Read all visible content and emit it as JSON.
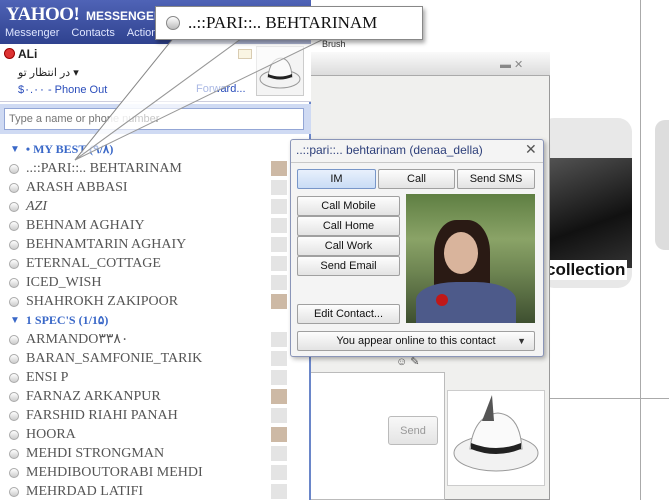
{
  "messenger": {
    "logo": "YAHOO!",
    "logo_sub": "MESSENGER",
    "menu": [
      "Messenger",
      "Contacts",
      "Actions"
    ],
    "user_name": "ALi",
    "user_status": "در انتظار تو",
    "phone_out": "$۰.۰۰ - Phone Out",
    "forward": "Forward...",
    "search_placeholder": "Type a name or phone number"
  },
  "groups": [
    {
      "label": "• MY BEST (۹/۸)",
      "contacts": [
        {
          "name": "..::PARI::.. BEHTARINAM",
          "pic": true
        },
        {
          "name": "ARASH ABBASI",
          "pic": false
        },
        {
          "name": "AZI",
          "pic": false
        },
        {
          "name": "BEHNAM AGHAIY",
          "pic": false
        },
        {
          "name": "BEHNAMTARIN AGHAIY",
          "pic": false
        },
        {
          "name": "ETERNAL_COTTAGE",
          "pic": false
        },
        {
          "name": "ICED_WISH",
          "pic": false
        },
        {
          "name": "SHAHROKH ZAKIPOOR",
          "pic": true
        }
      ]
    },
    {
      "label": "1 SPEC'S (1/1۵)",
      "contacts": [
        {
          "name": "ARMANDO۳۳۸۰",
          "pic": false
        },
        {
          "name": "BARAN_SAMFONIE_TARIK",
          "pic": false
        },
        {
          "name": "ENSI P",
          "pic": false
        },
        {
          "name": "FARNAZ ARKANPUR",
          "pic": true
        },
        {
          "name": "FARSHID RIAHI PANAH",
          "pic": false
        },
        {
          "name": "HOORA",
          "pic": true
        },
        {
          "name": "MEHDI STRONGMAN",
          "pic": false
        },
        {
          "name": "MEHDIBOUTORABI MEHDI",
          "pic": false
        },
        {
          "name": "MEHRDAD LATIFI",
          "pic": false
        }
      ]
    }
  ],
  "callout": {
    "text": "..::PARI::.. BEHTARINAM"
  },
  "chat": {
    "toolbar_label": "Brush",
    "send_label": "Send"
  },
  "popup": {
    "title": "..::pari::.. behtarinam (denaa_della)",
    "close": "✕",
    "tabs": {
      "im": "IM",
      "call": "Call",
      "sms": "Send SMS"
    },
    "actions": {
      "mobile": "Call Mobile",
      "home": "Call Home",
      "work": "Call Work",
      "email": "Send Email"
    },
    "edit_contact": "Edit Contact...",
    "appear_online": "You appear online to this contact"
  },
  "background": {
    "caption": "collection"
  }
}
